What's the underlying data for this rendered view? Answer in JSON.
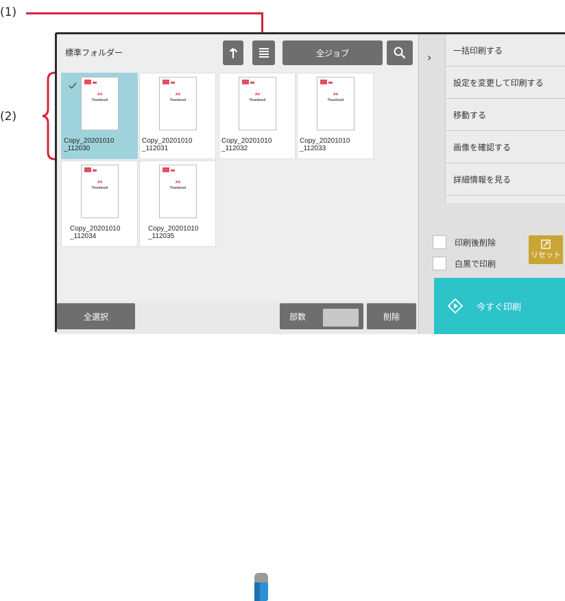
{
  "callouts": {
    "c1": "(1)",
    "c2": "(2)"
  },
  "folder_title": "標準フォルダー",
  "toolbar": {
    "refresh_icon": "refresh-icon",
    "list_icon": "list-view-icon",
    "all_jobs_label": "全ジョブ",
    "search_icon": "search-icon"
  },
  "thumbnails": [
    {
      "line1": "Copy_20201010",
      "line2": "_112030",
      "selected": true
    },
    {
      "line1": "Copy_20201010",
      "line2": "_112031",
      "selected": false
    },
    {
      "line1": "Copy_20201010",
      "line2": "_112032",
      "selected": false
    },
    {
      "line1": "Copy_20201010",
      "line2": "_112033",
      "selected": false
    },
    {
      "line1": "Copy_20201010",
      "line2": "_112034",
      "selected": false
    },
    {
      "line1": "Copy_20201010",
      "line2": "_112035",
      "selected": false
    }
  ],
  "thumb_page": {
    "size": "A4",
    "caption": "Thumbnail"
  },
  "bottombar": {
    "select_all": "全選択",
    "copies_label": "部数",
    "delete": "削除"
  },
  "menu": [
    "一括印刷する",
    "設定を変更して印刷する",
    "移動する",
    "画像を確認する",
    "詳細情報を見る"
  ],
  "options": {
    "delete_after_print": "印刷後削除",
    "bw_print": "白黒で印刷"
  },
  "reset_label": "リセット",
  "print_now_label": "今すぐ印刷",
  "colors": {
    "accent_cyan": "#2cc3c9",
    "selected_thumb": "#9fd3dc",
    "reset_gold": "#c9a536",
    "callout_red": "#d6233a",
    "button_gray": "#6e6e6e"
  }
}
